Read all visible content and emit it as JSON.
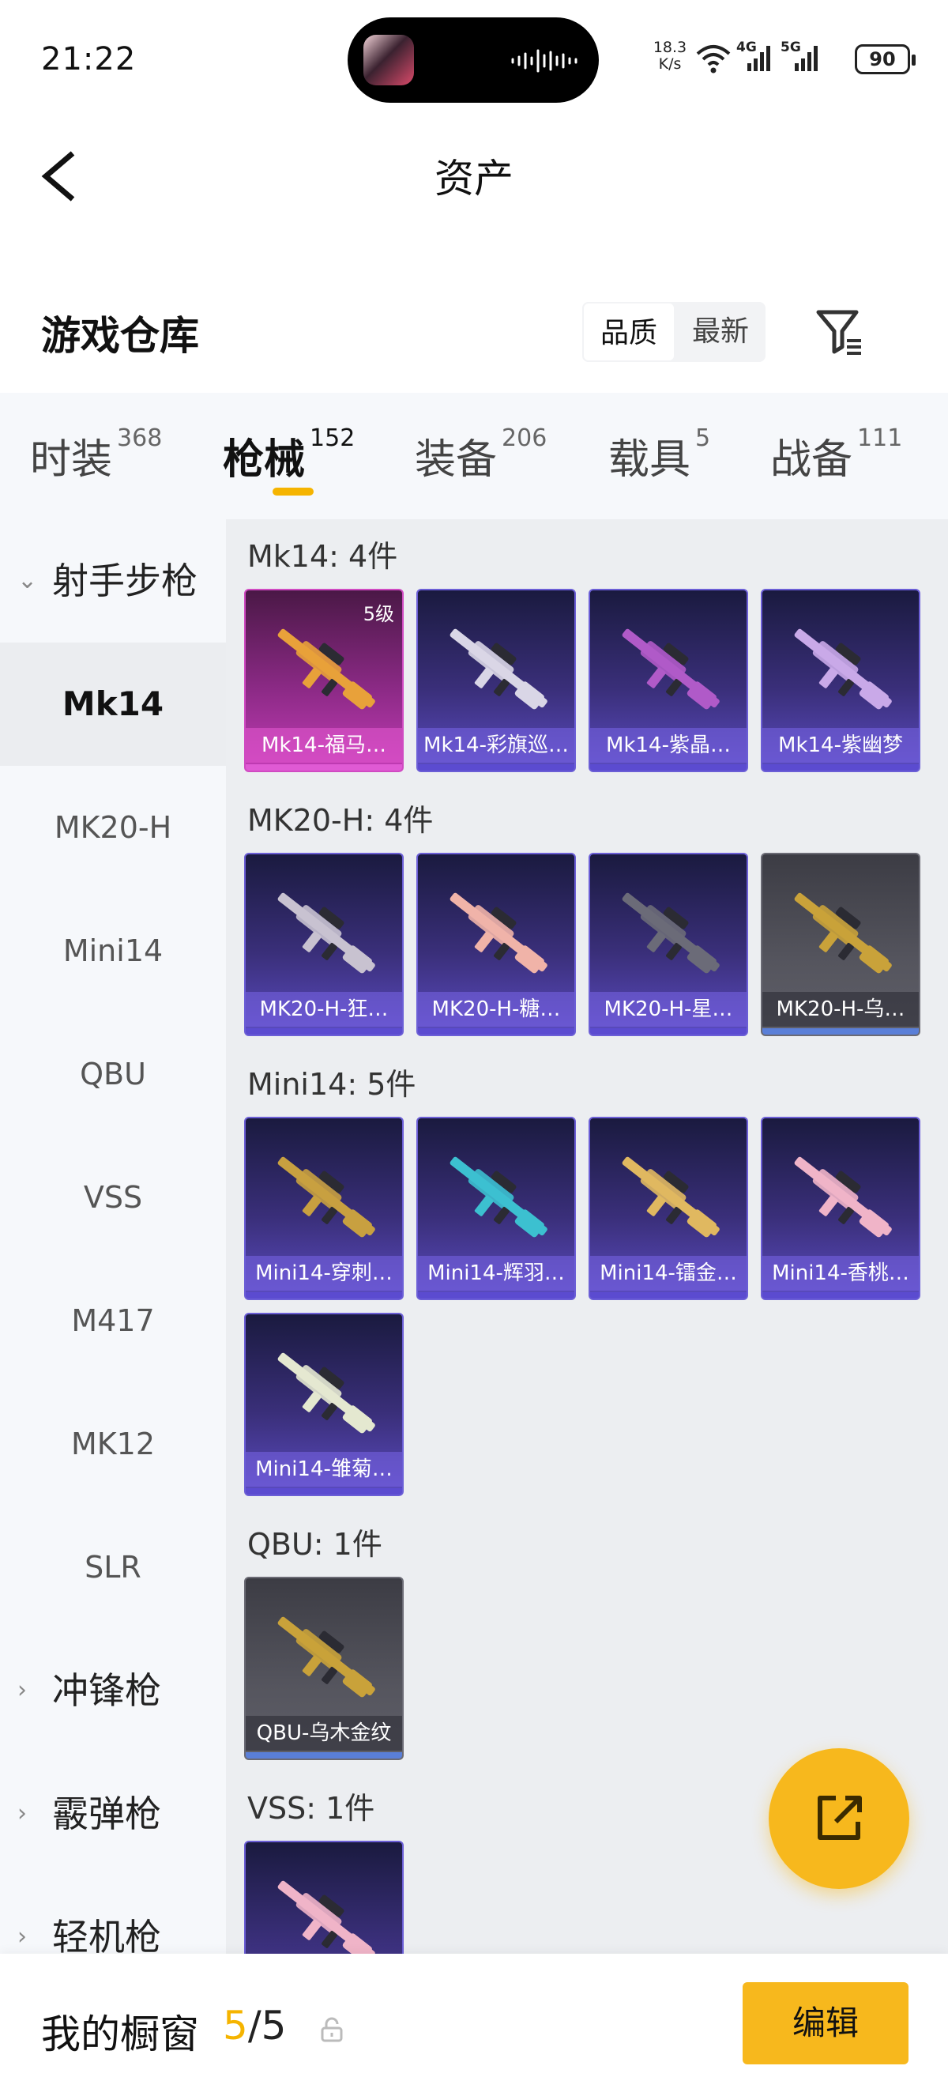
{
  "status_bar": {
    "time": "21:22",
    "net_speed": "18.3",
    "net_unit": "K/s",
    "net_4g": "4G",
    "net_5g": "5G",
    "battery": "90"
  },
  "header": {
    "title": "资产"
  },
  "warehouse": {
    "title": "游戏仓库",
    "sort_options": [
      "品质",
      "最新"
    ],
    "active_sort": "品质"
  },
  "categories": [
    {
      "label": "时装",
      "count": "368"
    },
    {
      "label": "枪械",
      "count": "152",
      "active": true
    },
    {
      "label": "装备",
      "count": "206"
    },
    {
      "label": "载具",
      "count": "5"
    },
    {
      "label": "战备",
      "count": "111"
    }
  ],
  "sidebar": {
    "groups": [
      {
        "label": "射手步枪",
        "expanded": true
      },
      {
        "label": "冲锋枪",
        "expanded": false
      },
      {
        "label": "霰弹枪",
        "expanded": false
      },
      {
        "label": "轻机枪",
        "expanded": false
      }
    ],
    "items": [
      "Mk14",
      "MK20-H",
      "Mini14",
      "QBU",
      "VSS",
      "M417",
      "MK12",
      "SLR"
    ],
    "active_item": "Mk14"
  },
  "sections": [
    {
      "title": "Mk14: 4件",
      "cards": [
        {
          "label": "Mk14-福马…",
          "level": "5级",
          "tier": "gold",
          "gun_color": "#e8a13a"
        },
        {
          "label": "Mk14-彩旗巡…",
          "tier": "purple",
          "gun_color": "#d9d6e6"
        },
        {
          "label": "Mk14-紫晶…",
          "tier": "purple",
          "gun_color": "#b05ac8"
        },
        {
          "label": "Mk14-紫幽梦",
          "tier": "purple",
          "gun_color": "#c9a9e8"
        }
      ]
    },
    {
      "title": "MK20-H: 4件",
      "cards": [
        {
          "label": "MK20-H-狂…",
          "tier": "purple",
          "gun_color": "#c8c2d0"
        },
        {
          "label": "MK20-H-糖…",
          "tier": "purple",
          "gun_color": "#f0b3a8"
        },
        {
          "label": "MK20-H-星…",
          "tier": "purple",
          "gun_color": "#6b6b78"
        },
        {
          "label": "MK20-H-乌…",
          "tier": "gray",
          "gun_color": "#c9a23a"
        }
      ]
    },
    {
      "title": "Mini14: 5件",
      "cards": [
        {
          "label": "Mini14-穿刺…",
          "tier": "purple",
          "gun_color": "#c8a040"
        },
        {
          "label": "Mini14-辉羽…",
          "tier": "purple",
          "gun_color": "#3cc0d0"
        },
        {
          "label": "Mini14-镭金…",
          "tier": "purple",
          "gun_color": "#e0b860"
        },
        {
          "label": "Mini14-香桃…",
          "tier": "purple",
          "gun_color": "#f0b4c8"
        },
        {
          "label": "Mini14-雏菊…",
          "tier": "purple",
          "gun_color": "#e4e8d0"
        }
      ]
    },
    {
      "title": "QBU: 1件",
      "cards": [
        {
          "label": "QBU-乌木金纹",
          "tier": "gray",
          "gun_color": "#c9a23a"
        }
      ]
    },
    {
      "title": "VSS: 1件",
      "cards": [
        {
          "label": "",
          "tier": "purple",
          "gun_color": "#f0b4c8"
        }
      ]
    }
  ],
  "bottom_bar": {
    "label": "我的橱窗",
    "count_current": "5",
    "count_total": "/5",
    "edit_label": "编辑"
  },
  "colors": {
    "accent": "#f7b81d",
    "active_underline": "#f5b400"
  }
}
